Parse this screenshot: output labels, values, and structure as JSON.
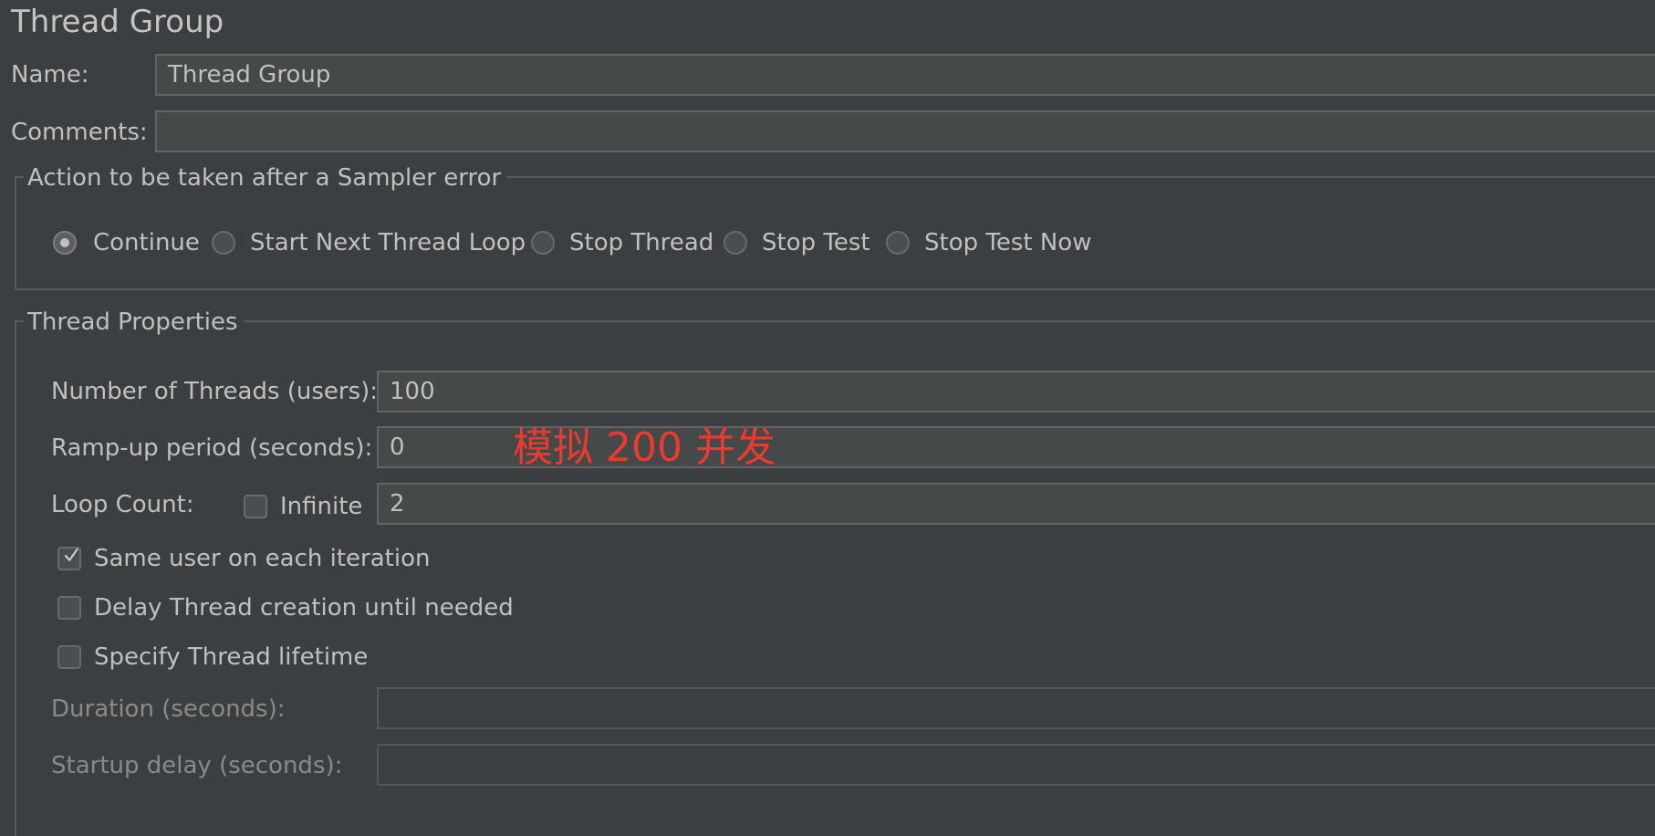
{
  "panel": {
    "title": "Thread Group",
    "name_label": "Name:",
    "name_value": "Thread Group",
    "comments_label": "Comments:",
    "comments_value": ""
  },
  "sampler_error": {
    "legend": "Action to be taken after a Sampler error",
    "options": [
      {
        "label": "Continue",
        "selected": true
      },
      {
        "label": "Start Next Thread Loop",
        "selected": false
      },
      {
        "label": "Stop Thread",
        "selected": false
      },
      {
        "label": "Stop Test",
        "selected": false
      },
      {
        "label": "Stop Test Now",
        "selected": false
      }
    ]
  },
  "thread_properties": {
    "legend": "Thread Properties",
    "threads_label": "Number of Threads (users):",
    "threads_value": "100",
    "rampup_label": "Ramp-up period (seconds):",
    "rampup_value": "0",
    "loop_label": "Loop Count:",
    "infinite_label": "Infinite",
    "infinite_checked": false,
    "loop_value": "2",
    "same_user_label": "Same user on each iteration",
    "same_user_checked": true,
    "delay_label": "Delay Thread creation until needed",
    "delay_checked": false,
    "lifetime_label": "Specify Thread lifetime",
    "lifetime_checked": false,
    "duration_label": "Duration (seconds):",
    "duration_value": "",
    "startup_delay_label": "Startup delay (seconds):",
    "startup_delay_value": ""
  },
  "annotation": {
    "text": "模拟 200 并发",
    "color": "#ec3b2d"
  },
  "colors": {
    "background": "#3c3f41",
    "field": "#45494a",
    "text": "#bbbbbb"
  }
}
